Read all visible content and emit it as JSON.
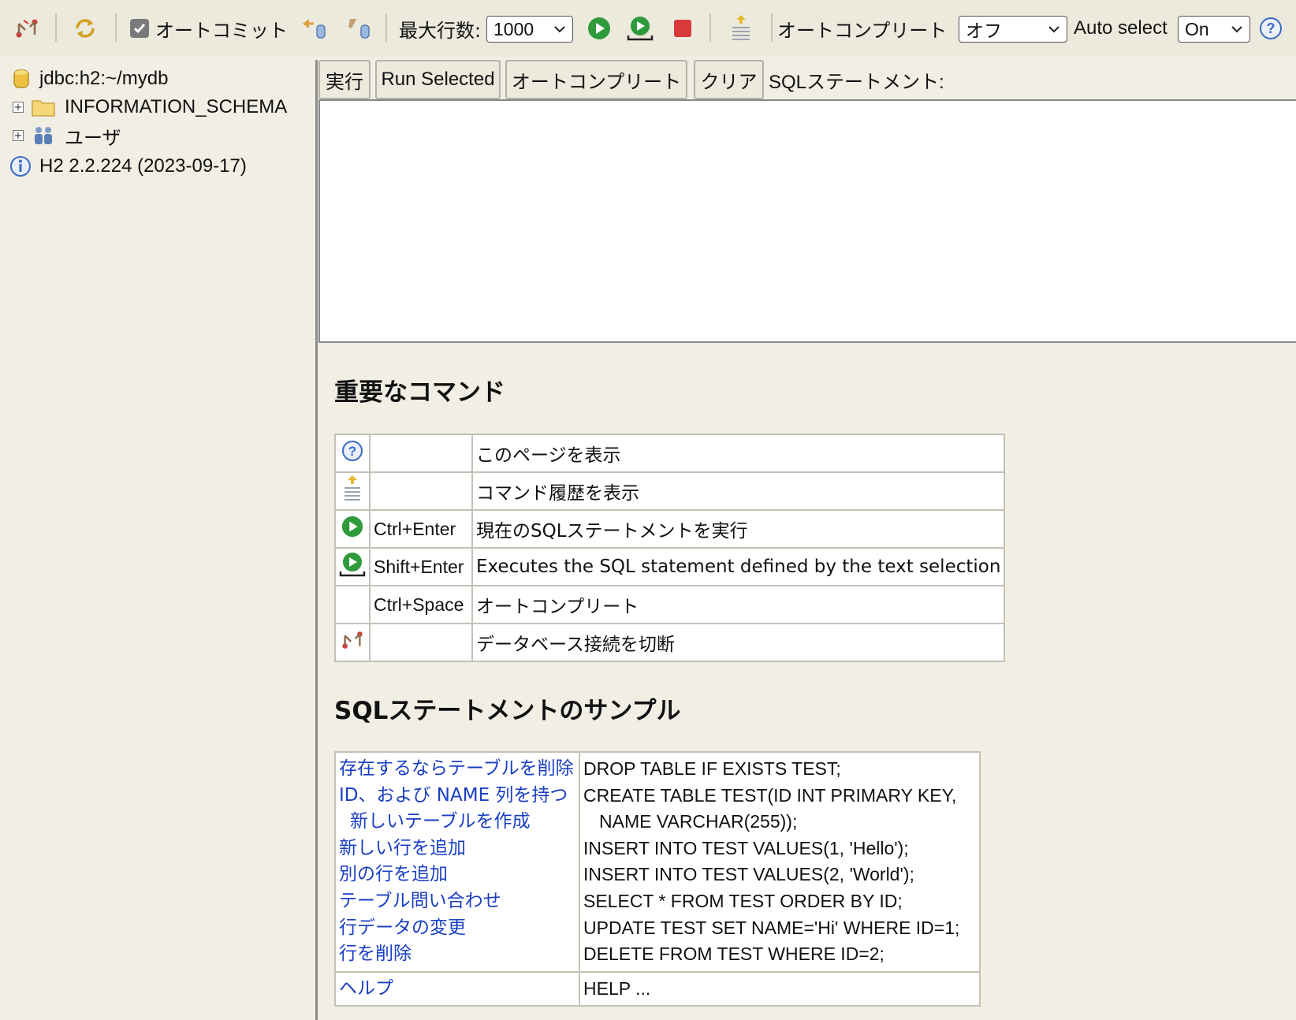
{
  "toolbar": {
    "disconnect_icon": "disconnect-icon",
    "refresh_icon": "refresh-icon",
    "autocommit_label": "オートコミット",
    "autocommit_checked": true,
    "rollback_icon": "rollback-icon",
    "commit_icon": "commit-icon",
    "max_rows_label": "最大行数:",
    "max_rows_value": "1000",
    "run_icon": "run-icon",
    "run_selected_icon": "run-selected-icon",
    "cancel_icon": "stop-icon",
    "history_icon": "history-icon",
    "autocomplete_label": "オートコンプリート",
    "autocomplete_value": "オフ",
    "autoselect_label": "Auto select",
    "autoselect_value": "On",
    "help_icon": "help-icon"
  },
  "tree": {
    "connection": "jdbc:h2:~/mydb",
    "items": [
      {
        "label": "INFORMATION_SCHEMA",
        "icon": "folder-icon"
      },
      {
        "label": "ユーザ",
        "icon": "users-icon"
      }
    ],
    "version": "H2 2.2.224 (2023-09-17)"
  },
  "actions": {
    "run": "実行",
    "run_selected": "Run Selected",
    "autocomplete": "オートコンプリート",
    "clear": "クリア",
    "sql_label": "SQLステートメント:"
  },
  "editor": {
    "value": ""
  },
  "commands": {
    "title": "重要なコマンド",
    "rows": [
      {
        "icon": "help-icon",
        "key": "",
        "desc": "このページを表示"
      },
      {
        "icon": "history-icon",
        "key": "",
        "desc": "コマンド履歴を表示"
      },
      {
        "icon": "run-icon",
        "key": "Ctrl+Enter",
        "desc": "現在のSQLステートメントを実行"
      },
      {
        "icon": "run-selected-icon",
        "key": "Shift+Enter",
        "desc": "Executes the SQL statement defined by the text selection"
      },
      {
        "icon": "",
        "key": "Ctrl+Space",
        "desc": "オートコンプリート"
      },
      {
        "icon": "disconnect-icon",
        "key": "",
        "desc": "データベース接続を切断"
      }
    ]
  },
  "samples": {
    "title": "SQLステートメントのサンプル",
    "links": {
      "drop": "存在するならテーブルを削除",
      "create_1": "ID、および NAME 列を持つ",
      "create_2": "新しいテーブルを作成",
      "insert1": "新しい行を追加",
      "insert2": "別の行を追加",
      "query": "テーブル問い合わせ",
      "update": "行データの変更",
      "delete": "行を削除",
      "help": "ヘルプ"
    },
    "code": {
      "drop": "DROP TABLE IF EXISTS TEST;",
      "create_1": "CREATE TABLE TEST(ID INT PRIMARY KEY,",
      "create_2": "NAME VARCHAR(255));",
      "insert1": "INSERT INTO TEST VALUES(1, 'Hello');",
      "insert2": "INSERT INTO TEST VALUES(2, 'World');",
      "query": "SELECT * FROM TEST ORDER BY ID;",
      "update": "UPDATE TEST SET NAME='Hi' WHERE ID=1;",
      "delete": "DELETE FROM TEST WHERE ID=2;",
      "help": "HELP ..."
    }
  }
}
